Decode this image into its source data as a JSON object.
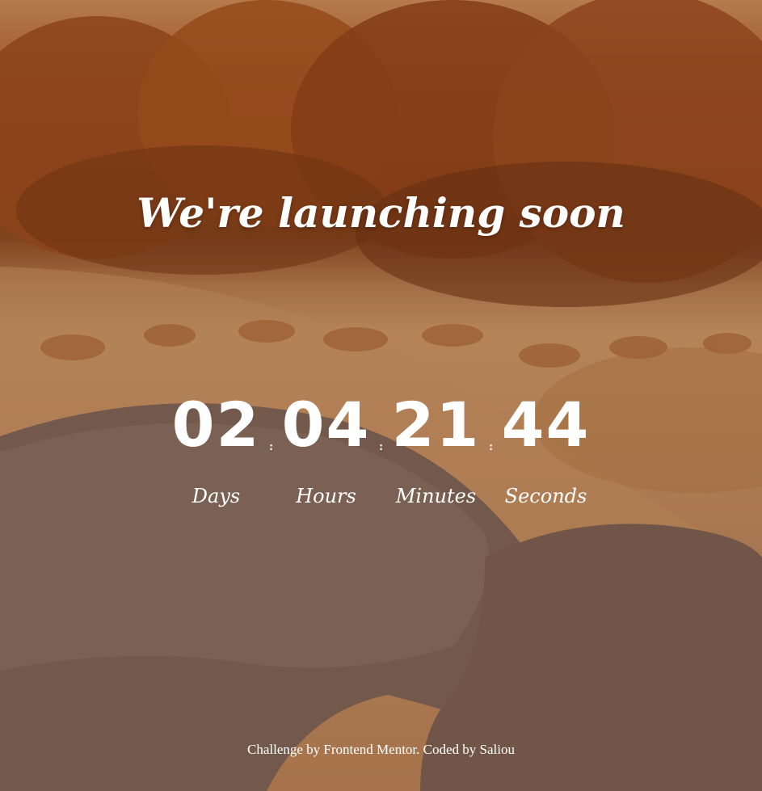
{
  "headline": "We're launching soon",
  "countdown": {
    "units": [
      {
        "value": "02",
        "label": "Days"
      },
      {
        "value": "04",
        "label": "Hours"
      },
      {
        "value": "21",
        "label": "Minutes"
      },
      {
        "value": "44",
        "label": "Seconds"
      }
    ],
    "separator": ":"
  },
  "footer": {
    "prefix": "Challenge by ",
    "link1": "Frontend Mentor",
    "middle": ". Coded by ",
    "link2": "Saliou"
  },
  "colors": {
    "text": "#ffffff",
    "background_tone": "#b07a52"
  }
}
